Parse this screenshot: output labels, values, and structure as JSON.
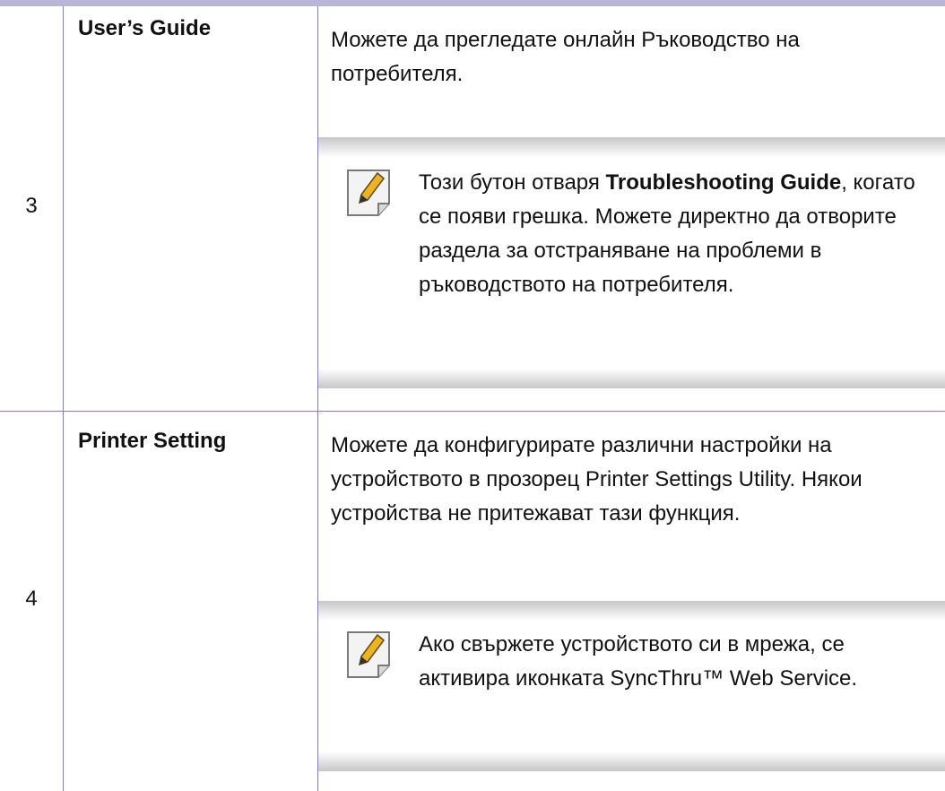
{
  "rows": [
    {
      "number": "3",
      "feature": "User’s Guide",
      "description": "Можете да прегледате онлайн Ръководство на потребителя.",
      "note": {
        "prefix": "Този бутон отваря ",
        "bold": "Troubleshooting Guide",
        "suffix": ", когато се появи грешка. Можете директно да отворите раздела за отстраняване на проблеми в ръководството на потребителя."
      }
    },
    {
      "number": "4",
      "feature": "Printer Setting",
      "description": "Можете да конфигурирате различни настройки на устройството в прозорец Printer Settings Utility. Някои устройства не притежават тази функция.",
      "note": {
        "text": "Ако свържете устройството си в мрежа, се активира иконката SyncThru™ Web Service."
      }
    }
  ],
  "icons": {
    "note": "note-pencil-icon"
  },
  "colors": {
    "rule": "#8480b8",
    "top_bar": "#b8b5d8",
    "note_band": "#c7c7c7",
    "pencil": "#f2b21b"
  }
}
